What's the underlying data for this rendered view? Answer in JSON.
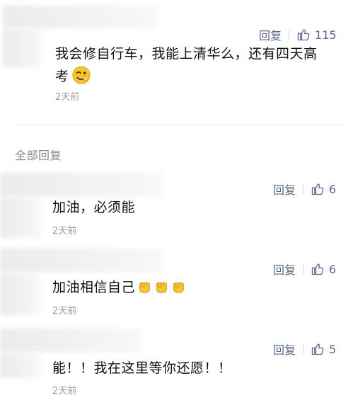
{
  "top_comment": {
    "text_line1": "我会修自行车，我能上清华么，还有四天高",
    "text_line2": "考",
    "emoji": "wink-face-emoji",
    "time": "2天前",
    "reply_label": "回复",
    "likes": "115"
  },
  "section_title": "全部回复",
  "replies": [
    {
      "text": "加油，必须能",
      "time": "2天前",
      "reply_label": "回复",
      "likes": "6"
    },
    {
      "text": "加油相信自己",
      "emojis": [
        "fist-emoji",
        "fist-emoji",
        "fist-emoji"
      ],
      "time": "2天前",
      "reply_label": "回复",
      "likes": "6"
    },
    {
      "text": "能！！我在这里等你还愿！！",
      "time": "2天前",
      "reply_label": "回复",
      "likes": "5"
    }
  ],
  "colors": {
    "action_text": "#5a6b8c",
    "time_text": "#9a9a9a",
    "section_text": "#8a8a8a",
    "body_text": "#111111",
    "emoji_yellow": "#f7c530"
  }
}
